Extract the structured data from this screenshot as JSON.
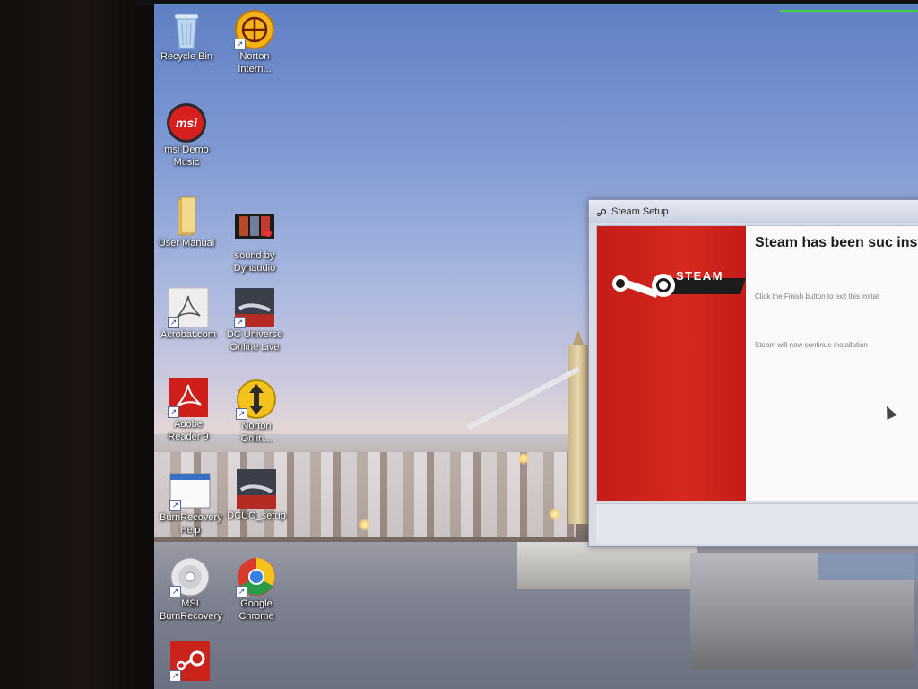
{
  "desktop": {
    "icons": [
      {
        "name": "recycle-bin",
        "label": "Recycle Bin"
      },
      {
        "name": "norton-internet",
        "label": "Norton\nIntern..."
      },
      {
        "name": "msi-demo-music",
        "label": "msi Demo\nMusic"
      },
      {
        "name": "user-manual",
        "label": "User Manual"
      },
      {
        "name": "sound-by-dynaudio",
        "label": "sound by\nDynaudio"
      },
      {
        "name": "acrobat-com",
        "label": "Acrobat.com"
      },
      {
        "name": "dc-universe-online-live",
        "label": "DC Universe\nOnline Live"
      },
      {
        "name": "adobe-reader-9",
        "label": "Adobe\nReader 9"
      },
      {
        "name": "norton-online",
        "label": "Norton\nOnlin..."
      },
      {
        "name": "burnrecovery-help",
        "label": "BurnRecovery\nHelp"
      },
      {
        "name": "dcuo-setup",
        "label": "DCUO_setup"
      },
      {
        "name": "msi-burnrecovery",
        "label": "MSI\nBurnRecovery"
      },
      {
        "name": "google-chrome",
        "label": "Google\nChrome"
      },
      {
        "name": "steam",
        "label": ""
      }
    ]
  },
  "steam_setup": {
    "title": "Steam Setup",
    "wordmark": "STEAM",
    "heading": "Steam has been suc installed.",
    "finish_text": "Click the Finish button to exit this instal",
    "continue_text": "Steam will now continue installation"
  },
  "colors": {
    "steam_red": "#d62820",
    "status_green": "#3cd63c"
  }
}
